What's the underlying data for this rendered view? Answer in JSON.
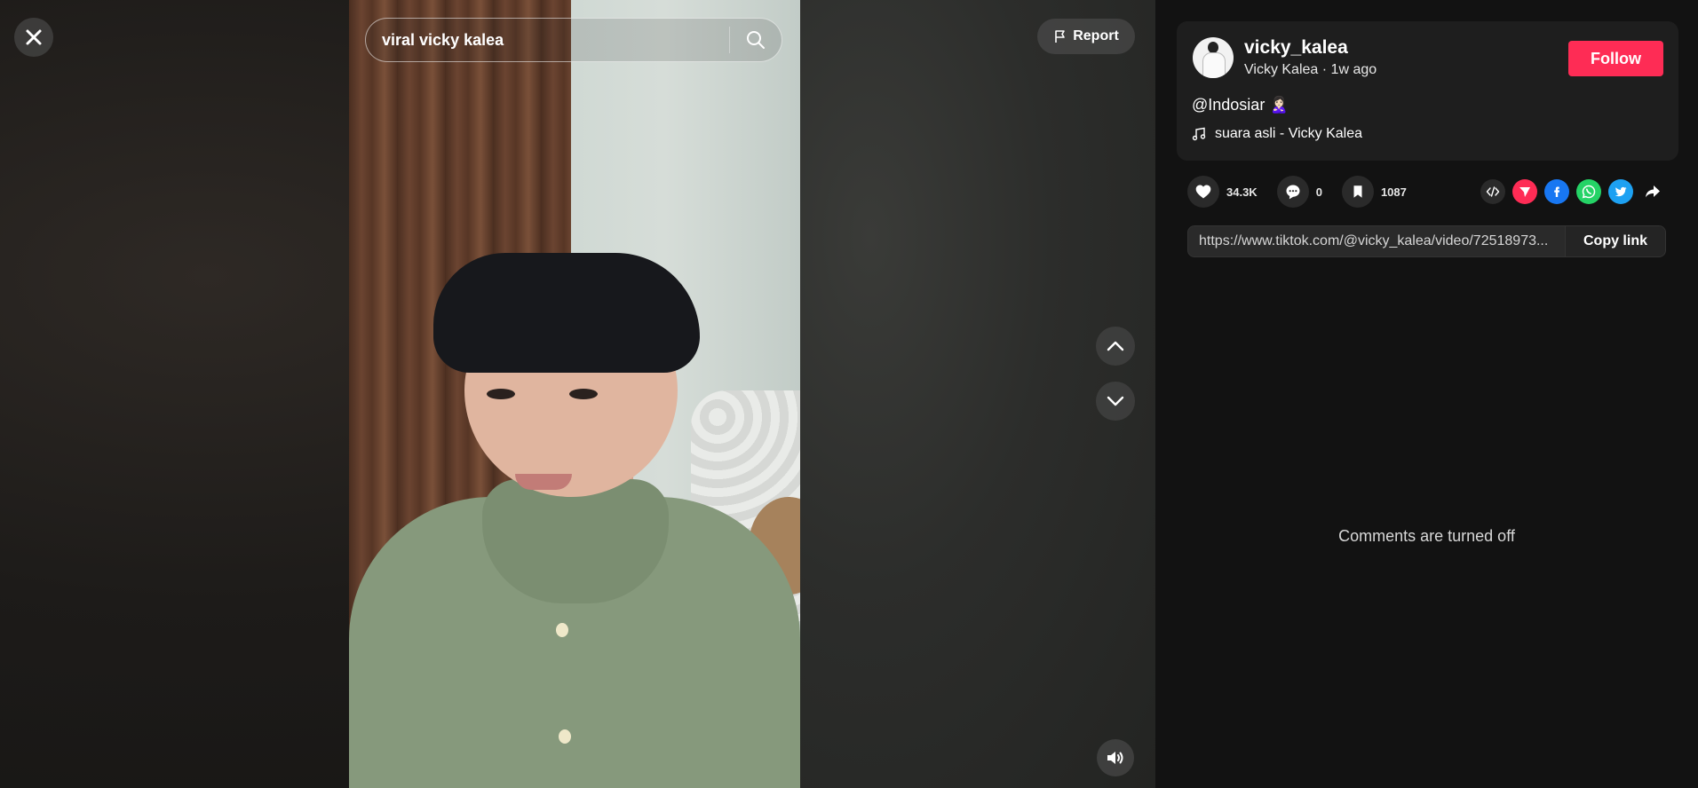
{
  "search": {
    "value": "viral vicky kalea"
  },
  "report_label": "Report",
  "author": {
    "username": "vicky_kalea",
    "display_name": "Vicky Kalea",
    "time_ago": "1w ago",
    "follow_label": "Follow"
  },
  "post": {
    "description": "@Indosiar 🙎🏻‍♀️",
    "music": "suara asli - Vicky Kalea"
  },
  "stats": {
    "likes": "34.3K",
    "comments": "0",
    "saves": "1087"
  },
  "link": {
    "url": "https://www.tiktok.com/@vicky_kalea/video/72518973...",
    "copy_label": "Copy link"
  },
  "comments_status": "Comments are turned off",
  "icons": {
    "close": "close-icon",
    "search": "search-icon",
    "report": "flag-icon",
    "up": "chevron-up-icon",
    "down": "chevron-down-icon",
    "volume": "volume-icon",
    "music": "music-note-icon",
    "like": "heart-icon",
    "comment": "comment-icon",
    "save": "bookmark-icon",
    "share_targets": [
      "embed-icon",
      "send-icon",
      "facebook-icon",
      "whatsapp-icon",
      "twitter-icon",
      "share-arrow-icon"
    ]
  },
  "colors": {
    "follow": "#fe2c55",
    "send": "#fe2c55",
    "facebook": "#1877f2",
    "whatsapp": "#25d366",
    "twitter": "#1da1f2"
  }
}
